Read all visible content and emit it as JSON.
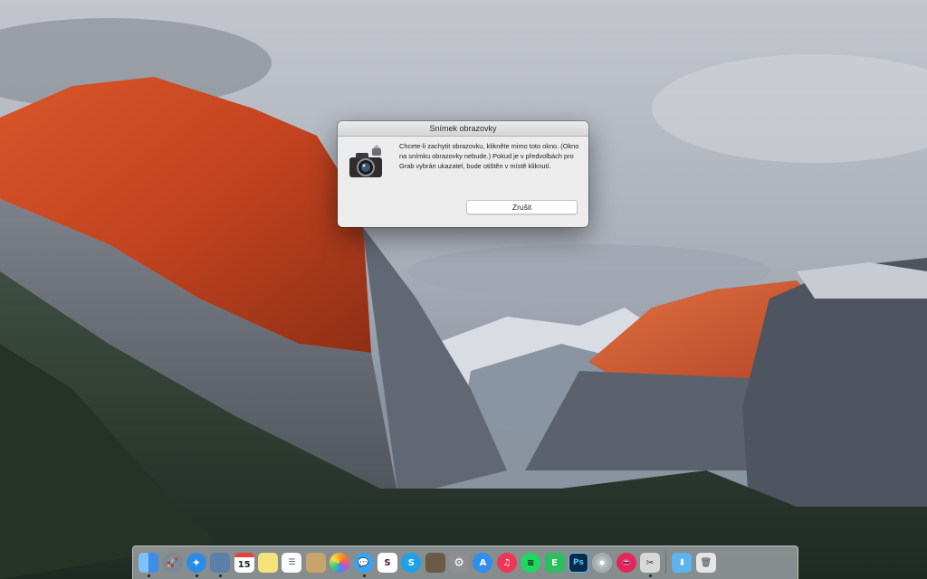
{
  "dialog": {
    "title": "Snímek obrazovky",
    "message": "Chcete-li zachytit obrazovku, klikněte mimo toto okno. (Okno na snímku obrazovky nebude.) Pokud je v předvolbách pro Grab vybrán ukazatel, bude otištěn v místě kliknutí.",
    "cancel_label": "Zrušit",
    "icon": "camera-icon"
  },
  "dock": {
    "calendar_day": "15",
    "photoshop_label": "Ps",
    "slack_label": "S",
    "items": [
      {
        "name": "finder",
        "icon": "finder-icon",
        "color": "#3b8fe8",
        "running": true
      },
      {
        "name": "launchpad",
        "icon": "rocket-icon",
        "color": "#7d8796",
        "running": false
      },
      {
        "name": "safari",
        "icon": "compass-icon",
        "color": "#2b8be6",
        "running": true
      },
      {
        "name": "preview",
        "icon": "preview-icon",
        "color": "#5a7fa8",
        "running": true
      },
      {
        "name": "calendar",
        "icon": "calendar-icon",
        "color": "#ffffff",
        "running": false
      },
      {
        "name": "notes",
        "icon": "notes-icon",
        "color": "#f6e27a",
        "running": false
      },
      {
        "name": "reminders",
        "icon": "reminders-icon",
        "color": "#fbfbfb",
        "running": false
      },
      {
        "name": "contacts",
        "icon": "contacts-icon",
        "color": "#c9a46a",
        "running": false
      },
      {
        "name": "photos",
        "icon": "photos-icon",
        "color": "#ffffff",
        "running": false
      },
      {
        "name": "messages",
        "icon": "messages-icon",
        "color": "#3aa3f0",
        "running": true
      },
      {
        "name": "slack",
        "icon": "slack-icon",
        "color": "#ffffff",
        "running": false
      },
      {
        "name": "skype",
        "icon": "skype-icon",
        "color": "#1da1e8",
        "running": false
      },
      {
        "name": "notebook",
        "icon": "notebook-icon",
        "color": "#6b5a45",
        "running": false
      },
      {
        "name": "system-preferences",
        "icon": "gear-icon",
        "color": "#8e8e93",
        "running": false
      },
      {
        "name": "app-store",
        "icon": "app-store-icon",
        "color": "#2e8ff0",
        "running": false
      },
      {
        "name": "itunes",
        "icon": "music-note-icon",
        "color": "#f0355b",
        "running": false
      },
      {
        "name": "spotify",
        "icon": "spotify-icon",
        "color": "#1ed760",
        "running": false
      },
      {
        "name": "evernote",
        "icon": "evernote-icon",
        "color": "#2dbe60",
        "running": false
      },
      {
        "name": "photoshop",
        "icon": "photoshop-icon",
        "color": "#0b2a4a",
        "running": false
      },
      {
        "name": "dvd-player",
        "icon": "disc-icon",
        "color": "#c9c9d0",
        "running": false
      },
      {
        "name": "lips-app",
        "icon": "lips-icon",
        "color": "#e5245a",
        "running": false
      },
      {
        "name": "grab",
        "icon": "grab-icon",
        "color": "#d8d8d8",
        "running": true
      },
      {
        "name": "downloads-folder",
        "icon": "folder-icon",
        "color": "#5cb3ee",
        "running": false
      },
      {
        "name": "trash",
        "icon": "trash-icon",
        "color": "#e3e5e8",
        "running": false
      }
    ]
  }
}
